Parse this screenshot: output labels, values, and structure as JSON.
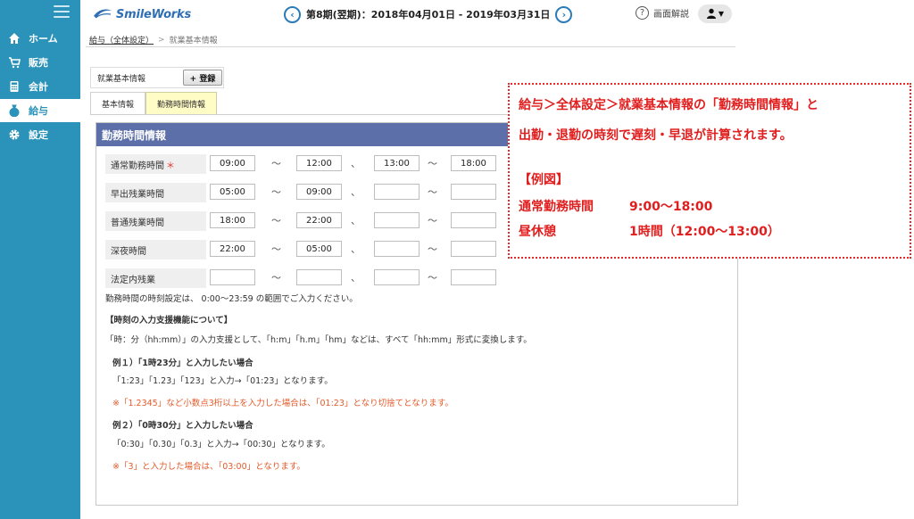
{
  "header": {
    "logo_text": "SmileWorks",
    "period": "第8期(翌期)：2018年04月01日 - 2019年03月31日",
    "prev_symbol": "‹",
    "next_symbol": "›",
    "help_label": "画面解説",
    "help_symbol": "?"
  },
  "sidebar": {
    "items": [
      {
        "label": "ホーム",
        "icon": "home-icon"
      },
      {
        "label": "販売",
        "icon": "cart-icon"
      },
      {
        "label": "会計",
        "icon": "calculator-icon"
      },
      {
        "label": "給与",
        "icon": "money-bag-icon"
      },
      {
        "label": "設定",
        "icon": "gear-icon"
      }
    ],
    "active_index": 3,
    "accent_color": "#2b93b9"
  },
  "breadcrumb": {
    "link": "給与（全体設定）",
    "separator": ">",
    "current": "就業基本情報"
  },
  "toolbar": {
    "title": "就業基本情報",
    "register_label": "+ 登録"
  },
  "tabs": [
    {
      "label": "基本情報",
      "active": false
    },
    {
      "label": "勤務時間情報",
      "active": true
    }
  ],
  "panel": {
    "title": "勤務時間情報",
    "title_color": "#5d6fa8",
    "range_sep": "〜",
    "break_sep": "、",
    "rows": [
      {
        "label": "通常勤務時間",
        "required": true,
        "required_mark": "＊",
        "values": [
          "09:00",
          "12:00",
          "13:00",
          "18:00"
        ]
      },
      {
        "label": "早出残業時間",
        "required": false,
        "values": [
          "05:00",
          "09:00",
          "",
          ""
        ]
      },
      {
        "label": "普通残業時間",
        "required": false,
        "values": [
          "18:00",
          "22:00",
          "",
          ""
        ]
      },
      {
        "label": "深夜時間",
        "required": false,
        "values": [
          "22:00",
          "05:00",
          "",
          ""
        ]
      },
      {
        "label": "法定内残業",
        "required": false,
        "values": [
          "",
          "",
          "",
          ""
        ]
      }
    ]
  },
  "notes": {
    "range": "勤務時間の時刻設定は、 0:00〜23:59 の範囲でご入力ください。",
    "heading": "【時刻の入力支援機能について】",
    "desc": "「時：分（hh:mm）」の入力支援として、「h:m」「h.m」「hm」などは、すべて「hh:mm」形式に変換します。",
    "ex1_title": "例１）「1時23分」と入力したい場合",
    "ex1_body": "「1:23」「1.23」「123」と入力→「01:23」となります。",
    "ex1_note": "※「1.2345」など小数点3桁以上を入力した場合は、「01:23」となり切捨てとなります。",
    "ex2_title": "例２）「0時30分」と入力したい場合",
    "ex2_body": "「0:30」「0.30」「0.3」と入力→「00:30」となります。",
    "ex2_note": "※「3」と入力した場合は、「03:00」となります。"
  },
  "callout": {
    "line1": "給与＞全体設定＞就業基本情報の「勤務時間情報」と",
    "line2": "出勤・退勤の時刻で遅刻・早退が計算されます。",
    "example_heading": "【例図】",
    "ex_label1": "通常勤務時間",
    "ex_value1": "9:00〜18:00",
    "ex_label2": "昼休憩",
    "ex_value2": "1時間（12:00〜13:00）",
    "color": "#e01e1e"
  }
}
